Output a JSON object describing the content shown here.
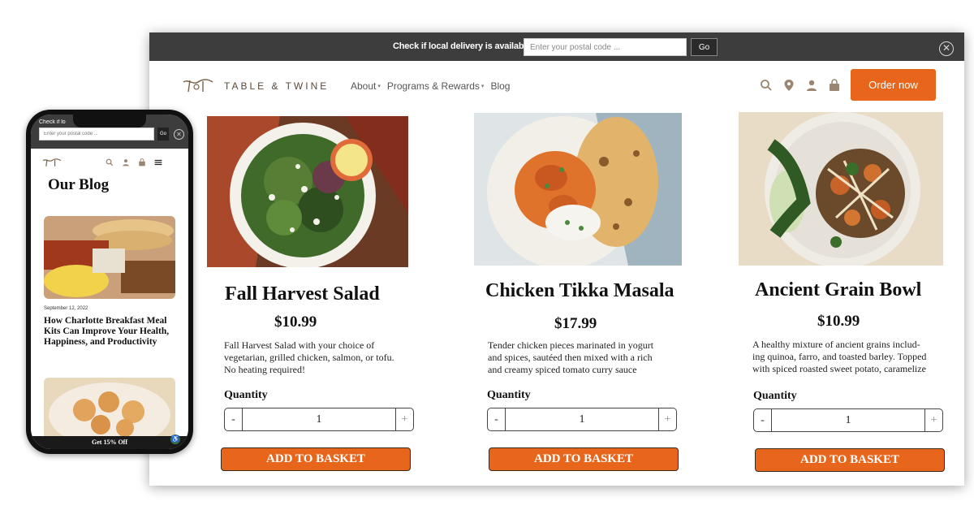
{
  "delivery_bar": {
    "label": "Check if local delivery is available",
    "postal_placeholder": "Enter your postal code ...",
    "go_label": "Go",
    "close_icon": "close-icon"
  },
  "header": {
    "brand": "TABLE & TWINE",
    "nav": [
      {
        "label": "About",
        "dropdown": true
      },
      {
        "label": "Programs & Rewards",
        "dropdown": true
      },
      {
        "label": "Blog",
        "dropdown": false
      }
    ],
    "icons": [
      "search-icon",
      "location-pin-icon",
      "user-icon",
      "basket-icon"
    ],
    "order_label": "Order now"
  },
  "colors": {
    "accent": "#e8661c",
    "dark_bar": "#3d3d3d",
    "brand_text": "#5a4a3a"
  },
  "products": [
    {
      "name": "Fall Harvest Salad",
      "price": "$10.99",
      "desc_lines": [
        "Fall Harvest Salad with your choice of",
        "vegetarian, grilled chicken, salmon, or tofu.",
        "No heating required!"
      ],
      "qty_label": "Quantity",
      "qty": "1",
      "minus": "-",
      "plus": "+",
      "add_label": "ADD TO BASKET"
    },
    {
      "name": "Chicken Tikka Masala",
      "price": "$17.99",
      "desc_lines": [
        "Tender chicken pieces marinated in yogurt",
        "and spices, sautéed then mixed with a rich",
        "and creamy spiced tomato curry sauce"
      ],
      "qty_label": "Quantity",
      "qty": "1",
      "minus": "-",
      "plus": "+",
      "add_label": "ADD TO BASKET"
    },
    {
      "name": "Ancient Grain Bowl",
      "price": "$10.99",
      "desc_lines": [
        "A healthy mixture of ancient grains includ-",
        "ing quinoa, farro, and toasted barley. Topped",
        "with spiced roasted sweet potato, caramelize"
      ],
      "qty_label": "Quantity",
      "qty": "1",
      "minus": "-",
      "plus": "+",
      "add_label": "ADD TO BASKET"
    }
  ],
  "mobile": {
    "delivery_label": "Check if lo",
    "postal_placeholder": "Enter your postal code ...",
    "go_label": "Go",
    "page_title": "Our Blog",
    "post_date": "September 12, 2022",
    "post_title": "How Charlotte Breakfast Meal Kits Can Improve Your Health, Happiness, and Productivity",
    "promo": "Get 15% Off",
    "icons": [
      "search-icon",
      "user-icon",
      "basket-icon",
      "menu-icon",
      "accessibility-icon"
    ]
  }
}
